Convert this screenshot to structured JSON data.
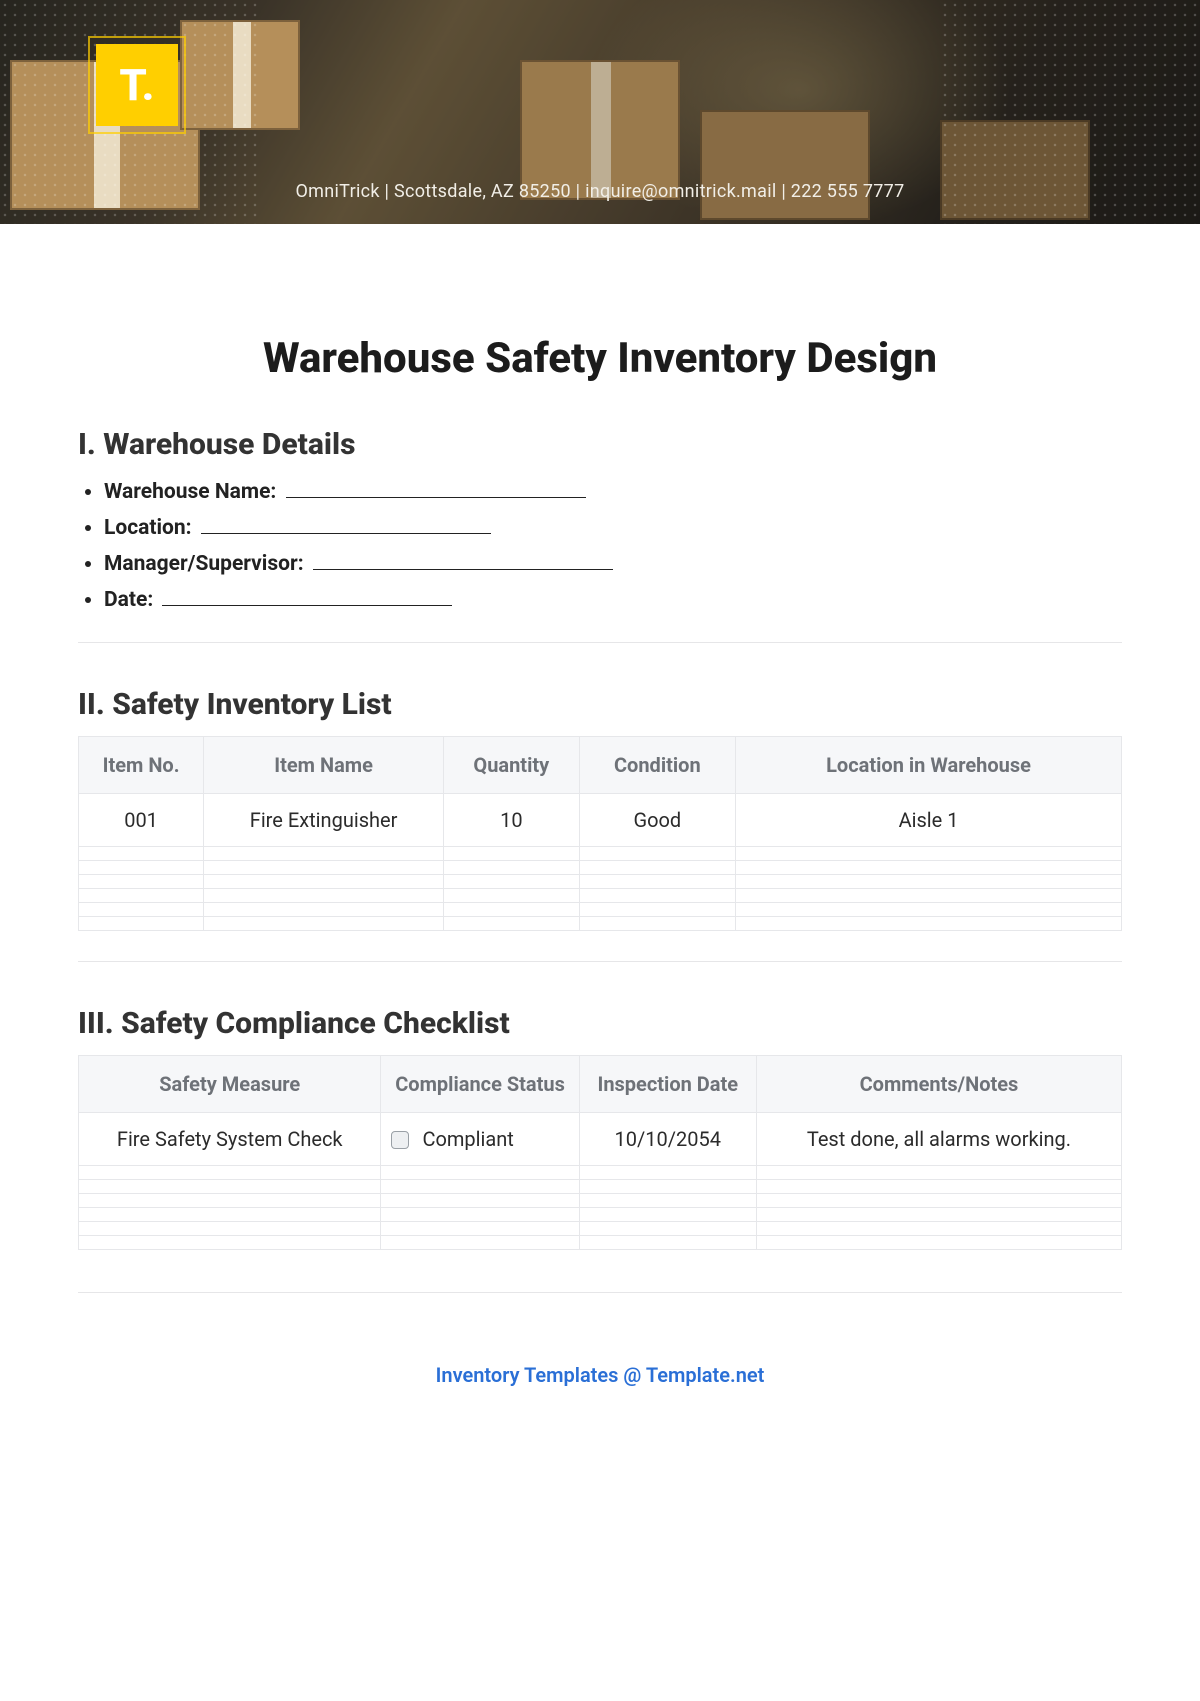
{
  "brand": {
    "mark": "T."
  },
  "banner": {
    "contact_line": "OmniTrick | Scottsdale, AZ 85250 | inquire@omnitrick.mail | 222 555 7777"
  },
  "title": "Warehouse Safety Inventory Design",
  "sections": {
    "details": {
      "heading": "I. Warehouse Details",
      "fields": {
        "warehouse_name": "Warehouse Name:",
        "location": "Location:",
        "manager": "Manager/Supervisor:",
        "date": "Date:"
      }
    },
    "inventory": {
      "heading": "II. Safety Inventory List",
      "headers": {
        "item_no": "Item No.",
        "item_name": "Item Name",
        "quantity": "Quantity",
        "condition": "Condition",
        "location": "Location in Warehouse"
      },
      "rows": [
        {
          "item_no": "001",
          "item_name": "Fire Extinguisher",
          "quantity": "10",
          "condition": "Good",
          "location": "Aisle 1"
        }
      ]
    },
    "compliance": {
      "heading": "III. Safety Compliance Checklist",
      "headers": {
        "measure": "Safety Measure",
        "status": "Compliance Status",
        "date": "Inspection Date",
        "comments": "Comments/Notes"
      },
      "rows": [
        {
          "measure": "Fire Safety System Check",
          "status_label": "Compliant",
          "date": "10/10/2054",
          "comments": "Test done, all alarms working."
        }
      ]
    }
  },
  "footer": {
    "text": "Inventory Templates @ Template.net"
  }
}
